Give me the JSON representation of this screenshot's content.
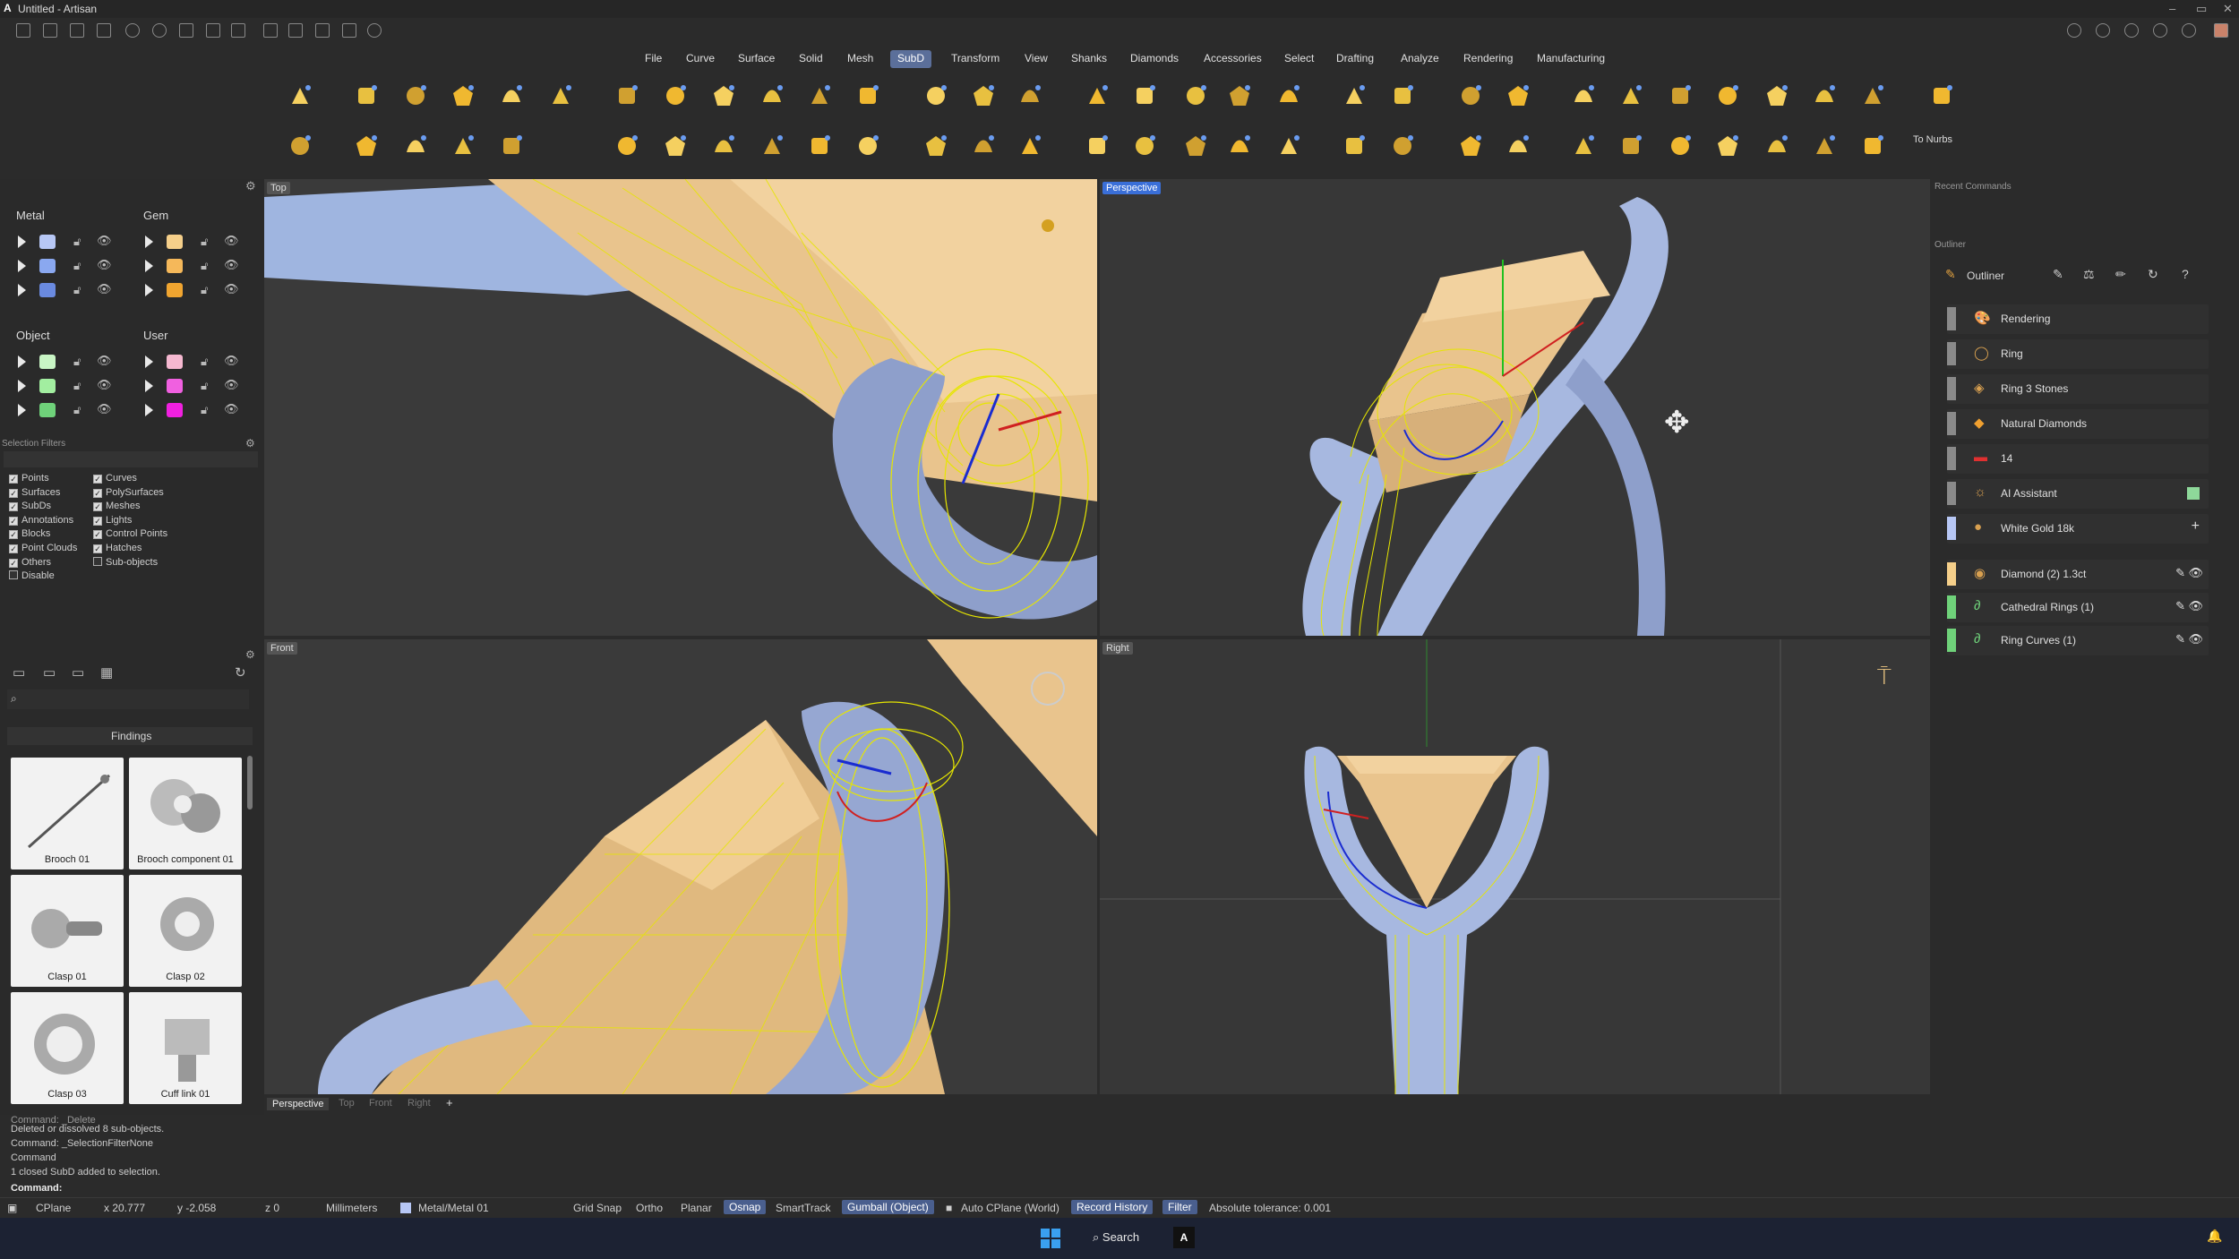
{
  "window": {
    "title": "Untitled - Artisan"
  },
  "menus": [
    "File",
    "Curve",
    "Surface",
    "Solid",
    "Mesh",
    "SubD",
    "Transform",
    "View",
    "Shanks",
    "Diamonds",
    "Accessories",
    "Select",
    "Drafting",
    "Analyze",
    "Rendering",
    "Manufacturing"
  ],
  "menu_active": "SubD",
  "toolbar": {
    "to_nurbs_label": "To Nurbs"
  },
  "layers": {
    "metal_label": "Metal",
    "gem_label": "Gem",
    "object_label": "Object",
    "user_label": "User",
    "metal_colors": [
      "#b7c7f5",
      "#8aa8f0",
      "#6a8ae0"
    ],
    "gem_colors": [
      "#f5cf8a",
      "#f5b85a",
      "#f0a530"
    ],
    "object_colors": [
      "#c9f5c5",
      "#a2eea0",
      "#6fd27a"
    ],
    "user_colors": [
      "#f5b8d0",
      "#f060e0",
      "#f020e0"
    ]
  },
  "selection_filters": {
    "title": "Selection Filters",
    "col1": [
      {
        "label": "Points",
        "on": true
      },
      {
        "label": "Surfaces",
        "on": true
      },
      {
        "label": "SubDs",
        "on": true
      },
      {
        "label": "Annotations",
        "on": true
      },
      {
        "label": "Blocks",
        "on": true
      },
      {
        "label": "Point Clouds",
        "on": true
      },
      {
        "label": "Others",
        "on": true
      },
      {
        "label": "Disable",
        "on": false
      }
    ],
    "col2": [
      {
        "label": "Curves",
        "on": true
      },
      {
        "label": "PolySurfaces",
        "on": true
      },
      {
        "label": "Meshes",
        "on": true
      },
      {
        "label": "Lights",
        "on": true
      },
      {
        "label": "Control Points",
        "on": true
      },
      {
        "label": "Hatches",
        "on": true
      },
      {
        "label": "Sub-objects",
        "on": false
      }
    ]
  },
  "findings": {
    "title": "Findings",
    "items": [
      "Brooch 01",
      "Brooch component 01",
      "Clasp 01",
      "Clasp 02",
      "Clasp 03",
      "Cuff link 01"
    ]
  },
  "viewports": {
    "top": "Top",
    "perspective": "Perspective",
    "front": "Front",
    "right": "Right"
  },
  "viewport_tabs": [
    "Perspective",
    "Top",
    "Front",
    "Right"
  ],
  "recent_commands_label": "Recent Commands",
  "outliner": {
    "panel_label": "Outliner",
    "title": "Outliner",
    "items": [
      {
        "label": "Rendering",
        "bar": "#8a8a8a",
        "icon": "🎨"
      },
      {
        "label": "Ring",
        "bar": "#8a8a8a",
        "icon": "◯"
      },
      {
        "label": "Ring 3 Stones",
        "bar": "#8a8a8a",
        "icon": "◈"
      },
      {
        "label": "Natural Diamonds",
        "bar": "#8a8a8a",
        "icon": "◆"
      },
      {
        "label": "14",
        "bar": "#8a8a8a",
        "icon": "▬"
      },
      {
        "label": "AI Assistant",
        "bar": "#8a8a8a",
        "icon": "☼"
      },
      {
        "label": "White Gold 18k",
        "bar": "#b7c7f5",
        "icon": "●"
      },
      {
        "label": "Diamond (2) 1.3ct",
        "bar": "#f5cf8a",
        "icon": "◉"
      },
      {
        "label": "Cathedral Rings (1)",
        "bar": "#6fd27a",
        "icon": "∂"
      },
      {
        "label": "Ring Curves (1)",
        "bar": "#6fd27a",
        "icon": "∂"
      }
    ]
  },
  "command": {
    "history": [
      "Command: _Delete",
      "Deleted or dissolved 8 sub-objects.",
      "Command: _SelectionFilterNone",
      "Command",
      "1 closed SubD added to selection."
    ],
    "prompt": "Command:"
  },
  "status": {
    "cplane": "CPlane",
    "x": "x 20.777",
    "y": "y -2.058",
    "z": "z 0",
    "units": "Millimeters",
    "layer": "Metal/Metal 01",
    "grid_snap": "Grid Snap",
    "ortho": "Ortho",
    "planar": "Planar",
    "osnap": "Osnap",
    "smarttrack": "SmartTrack",
    "gumball": "Gumball (Object)",
    "auto_cplane": "Auto CPlane (World)",
    "record_history": "Record History",
    "filter": "Filter",
    "tolerance": "Absolute tolerance: 0.001"
  },
  "taskbar": {
    "search": "Search"
  },
  "colors": {
    "accent": "#3a6fd8",
    "gem": "#e8c48a",
    "metal": "#9fb0d8",
    "wire": "#e6e600"
  }
}
